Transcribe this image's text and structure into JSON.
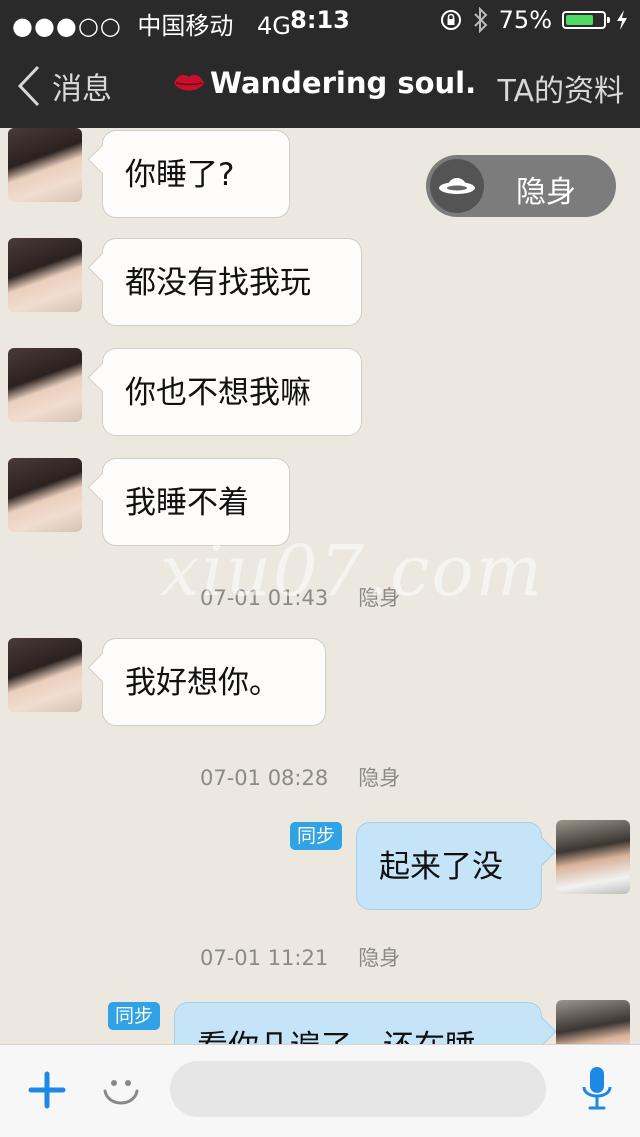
{
  "status_bar": {
    "signal_dots": "●●●○○",
    "carrier": "中国移动",
    "network": "4G",
    "time": "8:13",
    "battery_percent": "75%",
    "battery_level": 0.75
  },
  "nav": {
    "back_label": "消息",
    "title": "Wandering soul.",
    "profile_label": "TA的资料"
  },
  "stealth": {
    "label": "隐身"
  },
  "watermark": "xiu07.com",
  "messages": [
    {
      "text": "你睡了?"
    },
    {
      "text": "都没有找我玩"
    },
    {
      "text": "你也不想我嘛"
    },
    {
      "text": "我睡不着"
    },
    {
      "time": "07-01 01:43",
      "status": "隐身"
    },
    {
      "text": "我好想你。"
    },
    {
      "time": "07-01 08:28",
      "status": "隐身"
    },
    {
      "text": "起来了没",
      "badge": "同步"
    },
    {
      "time": "07-01 11:21",
      "status": "隐身"
    },
    {
      "text": "看你几遍了，还在睡",
      "badge": "同步"
    }
  ],
  "input": {
    "placeholder": ""
  },
  "colors": {
    "nav_background": "#2a2a2a",
    "accent_blue": "#2fa3e6",
    "sent_bubble": "#c5e4f7",
    "received_bubble": "#fdfcfa",
    "chat_background": "#ece7df",
    "battery_green": "#4cd964"
  },
  "icons": {
    "back": "chevron-left-icon",
    "title": "lips-icon",
    "stealth": "ufo-icon",
    "plus": "plus-icon",
    "emoji": "smiley-icon",
    "mic": "microphone-icon"
  }
}
